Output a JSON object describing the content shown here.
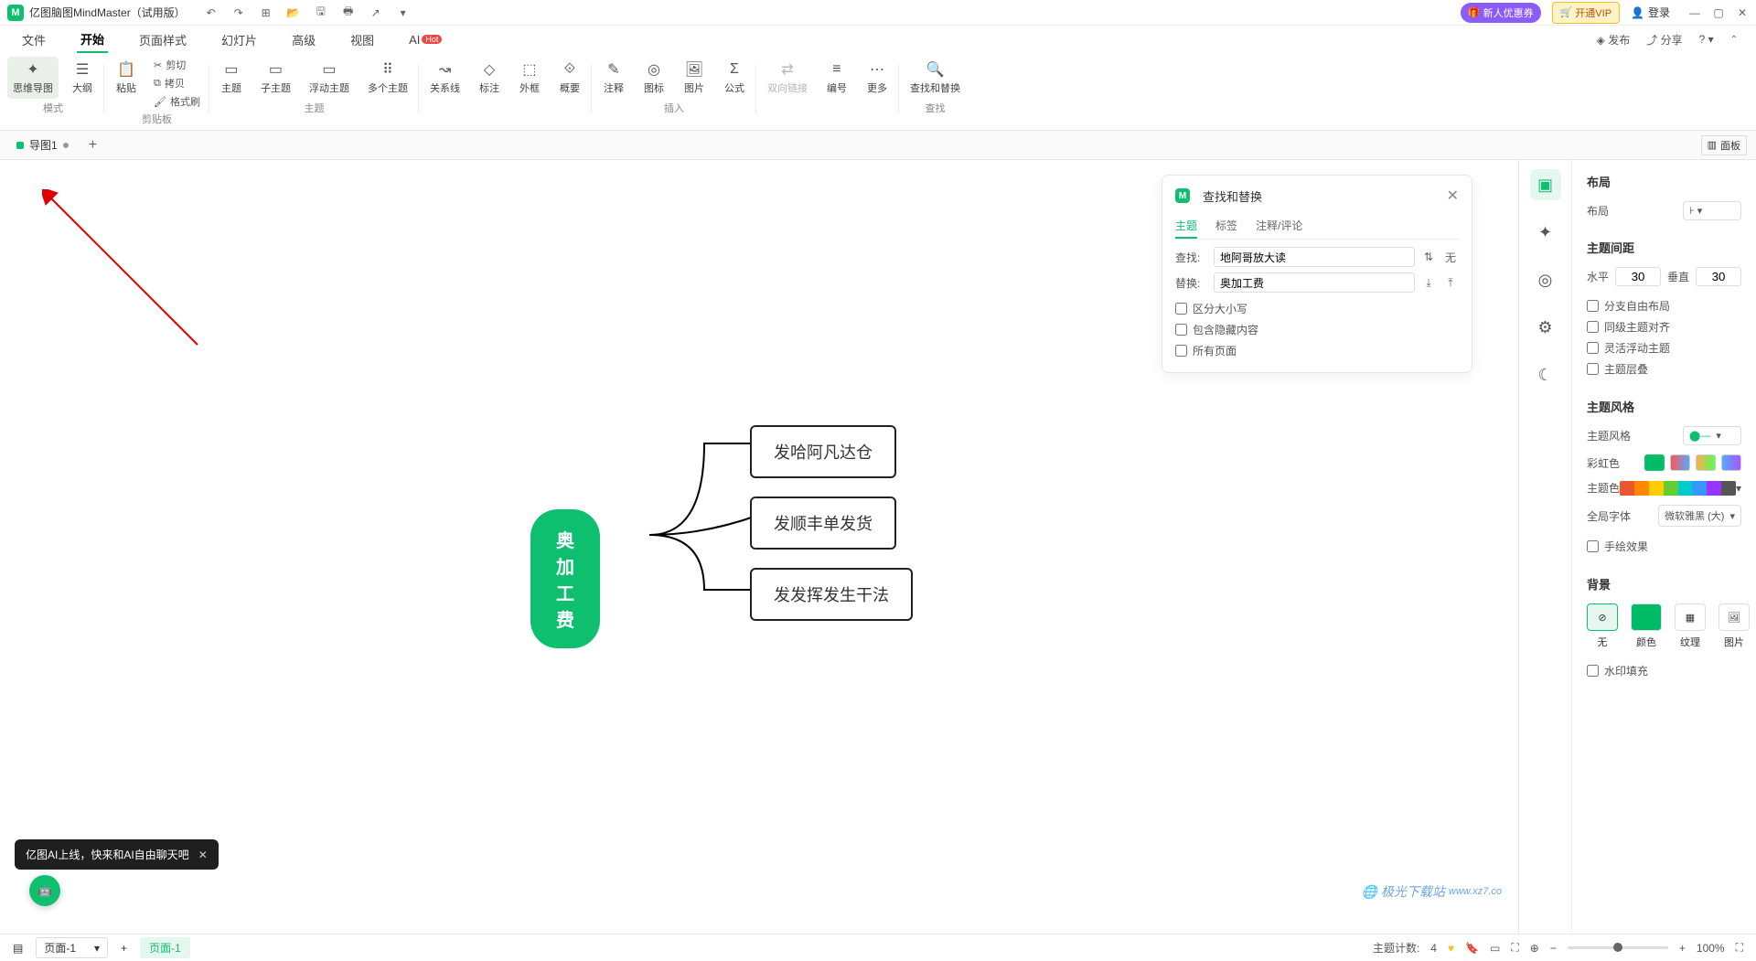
{
  "titlebar": {
    "app_title": "亿图脑图MindMaster（试用版）",
    "logo_letter": "M",
    "badge_new": "新人优惠券",
    "badge_vip": "开通VIP",
    "login": "登录"
  },
  "menubar": {
    "items": [
      "文件",
      "开始",
      "页面样式",
      "幻灯片",
      "高级",
      "视图",
      "AI"
    ],
    "hot": "Hot",
    "publish": "发布",
    "share": "分享"
  },
  "ribbon": {
    "mode_group": "模式",
    "mindmap": "思维导图",
    "outline": "大纲",
    "clipboard_group": "剪贴板",
    "paste": "粘贴",
    "cut": "剪切",
    "copy": "拷贝",
    "format_brush": "格式刷",
    "topic_group": "主题",
    "topic": "主题",
    "subtopic": "子主题",
    "floating": "浮动主题",
    "multi": "多个主题",
    "relation": "关系线",
    "callout": "标注",
    "boundary": "外框",
    "summary": "概要",
    "insert_group": "插入",
    "note": "注释",
    "marker": "图标",
    "image": "图片",
    "formula": "公式",
    "twoway": "双向链接",
    "number": "编号",
    "more": "更多",
    "find_group": "查找",
    "find_replace": "查找和替换"
  },
  "tabbar": {
    "doc": "导图1",
    "panel": "面板"
  },
  "mindmap": {
    "central": "奥加工费",
    "node1": "发哈阿凡达仓",
    "node2": "发顺丰单发货",
    "node3": "发发挥发生干法"
  },
  "find_panel": {
    "title": "查找和替换",
    "tabs": [
      "主题",
      "标签",
      "注释/评论"
    ],
    "find_label": "查找:",
    "find_value": "地阿哥放大读",
    "replace_label": "替换:",
    "replace_value": "奥加工费",
    "none": "无",
    "chk_case": "区分大小写",
    "chk_hidden": "包含隐藏内容",
    "chk_all": "所有页面"
  },
  "right_panel": {
    "layout_h": "布局",
    "layout_label": "布局",
    "spacing_h": "主题间距",
    "horizontal": "水平",
    "horizontal_val": "30",
    "vertical": "垂直",
    "vertical_val": "30",
    "chk_free": "分支自由布局",
    "chk_align": "同级主题对齐",
    "chk_float": "灵活浮动主题",
    "chk_stack": "主题层叠",
    "style_h": "主题风格",
    "style_label": "主题风格",
    "rainbow": "彩虹色",
    "theme_color": "主题色",
    "global_font": "全局字体",
    "font_value": "微软雅黑 (大)",
    "chk_hand": "手绘效果",
    "bg_h": "背景",
    "bg_none": "无",
    "bg_color": "颜色",
    "bg_texture": "纹理",
    "bg_image": "图片",
    "chk_watermark": "水印填充"
  },
  "ai_toast": {
    "text": "亿图AI上线，快来和AI自由聊天吧"
  },
  "statusbar": {
    "page_sel": "页面-1",
    "page_tab": "页面-1",
    "topic_count_label": "主题计数:",
    "topic_count": "4",
    "zoom": "100%"
  },
  "watermark": {
    "site": "极光下载站",
    "url": "www.xz7.co"
  }
}
